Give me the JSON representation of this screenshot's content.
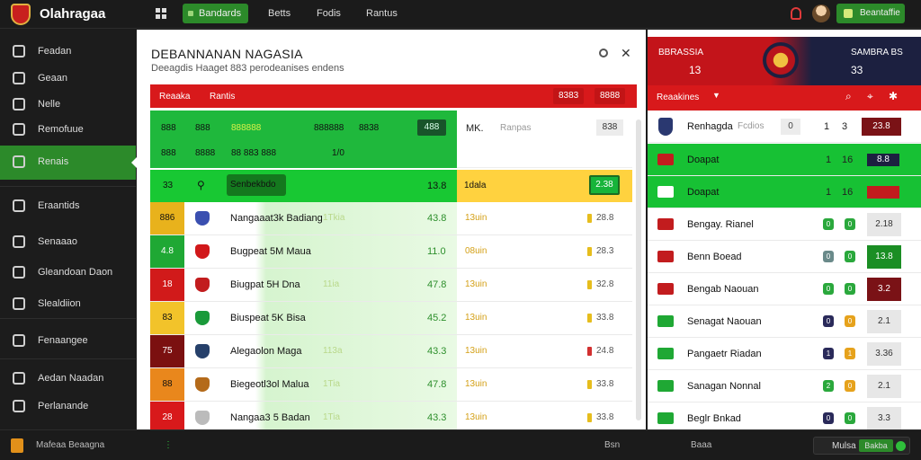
{
  "app": {
    "brand": "Olahragaa"
  },
  "topnav": {
    "items": [
      "Bandards",
      "Betts",
      "Fodis",
      "Rantus"
    ],
    "cta": "Beantaffie"
  },
  "sidebar": {
    "items": [
      {
        "label": "Feadan",
        "icon": "home-icon"
      },
      {
        "label": "Geaan",
        "icon": "chat-icon"
      },
      {
        "label": "Nelle",
        "icon": "box-icon"
      },
      {
        "label": "Remofuue",
        "icon": "grid-icon"
      },
      {
        "label": "Renais",
        "icon": "leaf-icon"
      },
      {
        "label": "Eraantids",
        "icon": "clock-icon"
      },
      {
        "label": "Senaaao",
        "icon": "doc-icon"
      },
      {
        "label": "Gleandoan Daon",
        "icon": "link-icon"
      },
      {
        "label": "Slealdiion",
        "icon": "pen-icon"
      },
      {
        "label": "Fenaangee",
        "icon": "list-icon"
      },
      {
        "label": "Aedan Naadan",
        "icon": "folder-icon"
      },
      {
        "label": "Perlanande",
        "icon": "settings-icon"
      }
    ]
  },
  "main": {
    "title": "DEBANNANAN NAGASIA",
    "subtitle": "Deeagdis Haaget 883 perodeanises endens",
    "redbar": {
      "left": "Reaaka",
      "mid": "Rantis",
      "b1": "8383",
      "b2": "8888"
    },
    "header": {
      "c1": "888",
      "c2": "888",
      "c3": "888888",
      "c4": "888888",
      "c5": "8838",
      "c6": "888",
      "c7": "8888",
      "c8": "88 883 888",
      "c9": "1/0",
      "badge": "488",
      "right_label": "MK.",
      "right_sub": "Ranpas",
      "right_badge": "838"
    },
    "highlight": {
      "num": "33",
      "label": "Senbekbdo",
      "value": "13.8",
      "right_label": "1dala",
      "right_badge": "2.38"
    },
    "rows": [
      {
        "pos": "886",
        "color": "#e8b21c",
        "crest": "#3a4fb0",
        "name": "Nangaaat3k Badiang",
        "tag": "1Tkia",
        "value": "43.8",
        "rtext": "13uin",
        "rbadge": "28.8",
        "rcolor": "yellow"
      },
      {
        "pos": "4.8",
        "color": "#1fa834",
        "crest": "#d1181a",
        "name": "Bugpeat 5M Maua",
        "tag": "",
        "value": "11.0",
        "rtext": "08uin",
        "rbadge": "28.3",
        "rcolor": "yellow"
      },
      {
        "pos": "18",
        "color": "#d11a1a",
        "crest": "#c21c1e",
        "name": "Biugpat 5H Dna",
        "tag": "11ia",
        "value": "47.8",
        "rtext": "13uin",
        "rbadge": "32.8",
        "rcolor": "yellow"
      },
      {
        "pos": "83",
        "color": "#f2c32a",
        "crest": "#1a9a3a",
        "name": "Biuspeat 5K Bisa",
        "tag": "",
        "value": "45.2",
        "rtext": "13uin",
        "rbadge": "33.8",
        "rcolor": "yellow"
      },
      {
        "pos": "75",
        "color": "#7b1010",
        "crest": "#26406a",
        "name": "Alegaolon Maga",
        "tag": "113a",
        "value": "43.3",
        "rtext": "13uin",
        "rbadge": "24.8",
        "rcolor": "red"
      },
      {
        "pos": "88",
        "color": "#e9871c",
        "crest": "#b46a1a",
        "name": "Biegeotl3ol Malua",
        "tag": "1Tia",
        "value": "47.8",
        "rtext": "13uin",
        "rbadge": "33.8",
        "rcolor": "yellow"
      },
      {
        "pos": "28",
        "color": "#d8191b",
        "crest": "#bbbbbb",
        "name": "Nangaa3 5 Badan",
        "tag": "1Tia",
        "value": "43.3",
        "rtext": "13uin",
        "rbadge": "33.8",
        "rcolor": "yellow"
      }
    ]
  },
  "right": {
    "head": {
      "left_title": "BBRASSIA",
      "left_num": "13",
      "right_title": "SAMBRA BS",
      "right_num": "33"
    },
    "tab": {
      "label": "Reaakines"
    },
    "team": {
      "name": "Renhagda",
      "tag": "Fcdios",
      "a": "0",
      "b": "1",
      "c": "3",
      "odd": "23.8"
    },
    "rows": [
      {
        "name": "Doapat",
        "n1": "1",
        "n2": "16",
        "odd": "8.8",
        "green": true,
        "flag": "#c21c1e",
        "oddbg": "#1c2040",
        "oddfg": "#fff"
      },
      {
        "name": "Doapat",
        "n1": "1",
        "n2": "16",
        "odd": "",
        "green": true,
        "flag": "#fff",
        "oddbg": "#c21c1e",
        "oddfg": "#fff"
      },
      {
        "name": "Bengay. Rianel",
        "n1": "0",
        "n2": "0",
        "odd": "2.18",
        "green": false,
        "flag": "#c21c1e",
        "c1": "#2aa83c",
        "c2": "#2aa83c"
      },
      {
        "name": "Benn Boead",
        "n1": "0",
        "n2": "0",
        "odd": "13.8",
        "green": false,
        "flag": "#c21c1e",
        "c1": "#6a8a8a",
        "c2": "#2aa83c",
        "oddbg": "#1b8e24",
        "oddfg": "#fff"
      },
      {
        "name": "Bengab Naouan",
        "n1": "0",
        "n2": "0",
        "odd": "3.2",
        "green": false,
        "flag": "#c21c1e",
        "c1": "#2aa83c",
        "c2": "#2aa83c",
        "oddbg": "#7a1216",
        "oddfg": "#fff"
      },
      {
        "name": "Senagat Naouan",
        "n1": "0",
        "n2": "0",
        "odd": "2.1",
        "green": false,
        "flag": "#1fa834",
        "c1": "#2a2a5a",
        "c2": "#e6a21c"
      },
      {
        "name": "Pangaetr Riadan",
        "n1": "1",
        "n2": "1",
        "odd": "3.36",
        "green": false,
        "flag": "#1fa834",
        "c1": "#2a2a5a",
        "c2": "#e6a21c"
      },
      {
        "name": "Sanagan Nonnal",
        "n1": "2",
        "n2": "0",
        "odd": "2.1",
        "green": false,
        "flag": "#1fa834",
        "c1": "#2aa83c",
        "c2": "#e6a21c"
      },
      {
        "name": "Beglr Bnkad",
        "n1": "0",
        "n2": "0",
        "odd": "3.3",
        "green": false,
        "flag": "#1fa834",
        "c1": "#2a2a5a",
        "c2": "#2aa83c"
      }
    ]
  },
  "bottom": {
    "left": "Mafeaa Beaagna",
    "m1": "Bsn",
    "m2": "Baaa",
    "btn": "Mulsa",
    "btn_sub": "Bakba"
  }
}
